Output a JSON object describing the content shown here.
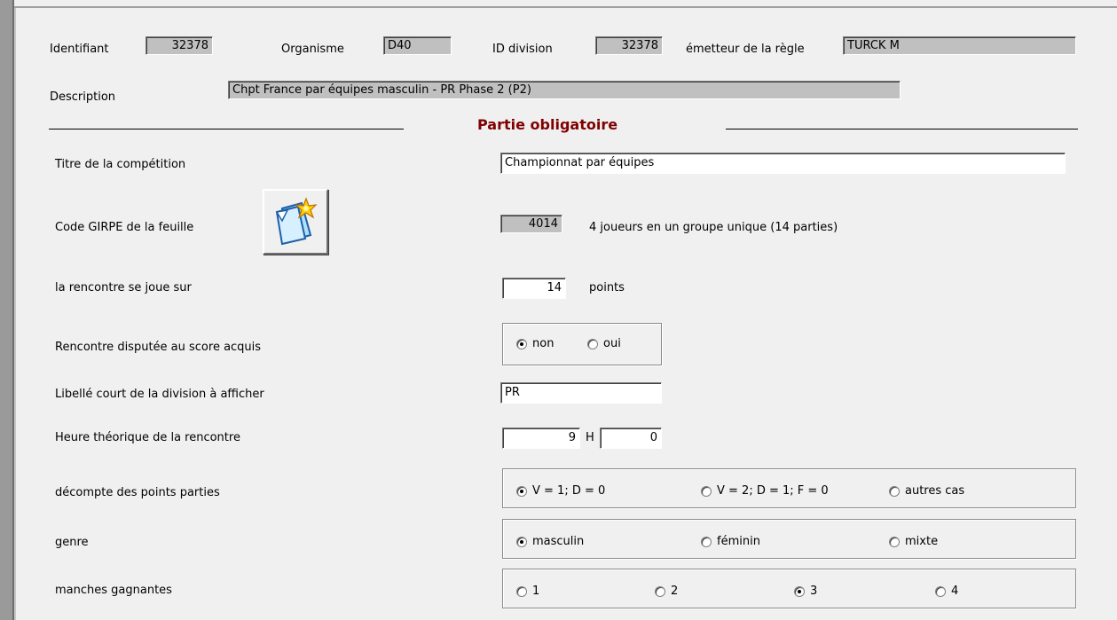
{
  "header": {
    "identifiant_label": "Identifiant",
    "identifiant_value": "32378",
    "organisme_label": "Organisme",
    "organisme_value": "D40",
    "id_division_label": "ID division",
    "id_division_value": "32378",
    "emetteur_label": "émetteur de la règle",
    "emetteur_value": "TURCK M",
    "description_label": "Description",
    "description_value": "Chpt France par équipes masculin - PR Phase 2 (P2)"
  },
  "section_title": "Partie obligatoire",
  "form": {
    "titre_label": "Titre de la compétition",
    "titre_value": "Championnat par équipes",
    "girpe_label": "Code GIRPE de la feuille",
    "girpe_icon": "new-document-star-icon",
    "girpe_code": "4014",
    "girpe_desc": "4 joueurs en un groupe unique (14 parties)",
    "points_label": "la rencontre se joue sur",
    "points_value": "14",
    "points_unit": "points",
    "score_label": "Rencontre disputée au score acquis",
    "score_options": [
      "non",
      "oui"
    ],
    "score_selected": "non",
    "libelle_label": "Libellé court de la division à afficher",
    "libelle_value": "PR",
    "heure_label": "Heure théorique de la rencontre",
    "heure_h": "9",
    "heure_sep": "H",
    "heure_m": "0",
    "decompte_label": "décompte des points parties",
    "decompte_options": [
      "V = 1; D = 0",
      "V = 2; D = 1; F = 0",
      "autres cas"
    ],
    "decompte_selected": "V = 1; D = 0",
    "genre_label": "genre",
    "genre_options": [
      "masculin",
      "féminin",
      "mixte"
    ],
    "genre_selected": "masculin",
    "manches_label": "manches gagnantes",
    "manches_options": [
      "1",
      "2",
      "3",
      "4"
    ],
    "manches_selected": "3"
  },
  "colors": {
    "section_title": "#800000",
    "readonly_bg": "#c0c0c0",
    "window_bg": "#f0f0f0"
  }
}
